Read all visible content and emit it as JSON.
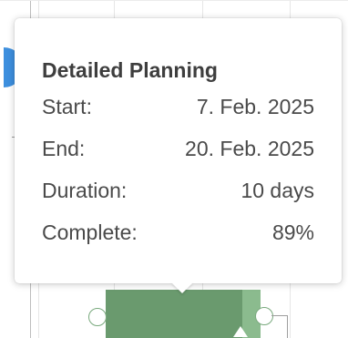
{
  "tooltip": {
    "title": "Detailed Planning",
    "rows": [
      {
        "label": "Start:",
        "value": "7. Feb. 2025"
      },
      {
        "label": "End:",
        "value": "20. Feb. 2025"
      },
      {
        "label": "Duration:",
        "value": "10 days"
      },
      {
        "label": "Complete:",
        "value": "89%"
      }
    ]
  },
  "task": {
    "progress_fraction": 0.89
  },
  "colors": {
    "task_bar": "#6e9e72",
    "task_bar_remaining": "#8bbb8e",
    "node_accent": "#3d8fde",
    "grid": "#e6e6e6"
  }
}
